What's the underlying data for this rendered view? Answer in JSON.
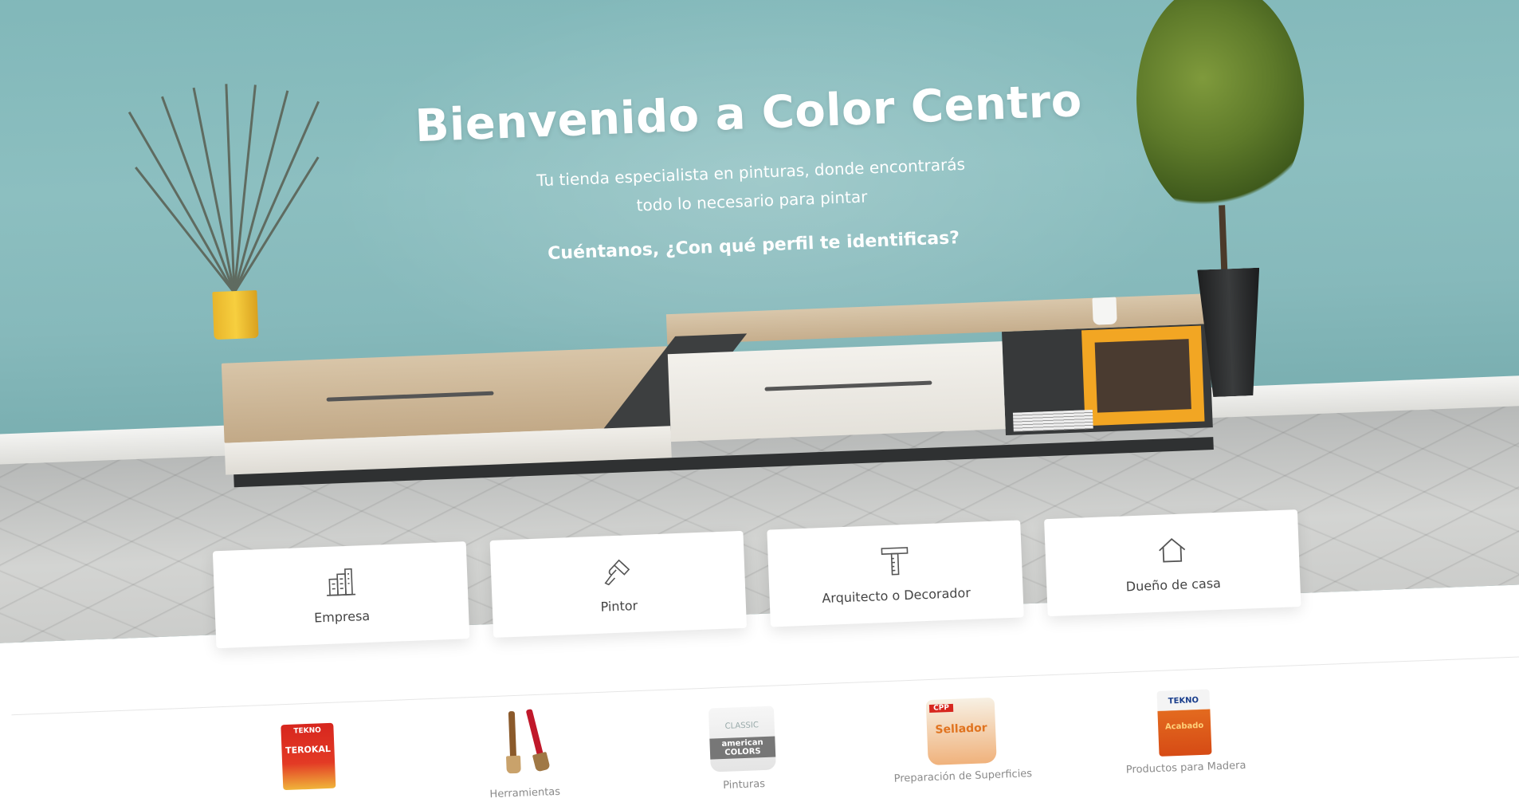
{
  "hero": {
    "title": "Bienvenido a Color Centro",
    "subtitle_line1": "Tu tienda especialista en pinturas, donde encontrarás",
    "subtitle_line2": "todo lo necesario para pintar",
    "question": "Cuéntanos, ¿Con qué perfil te identificas?"
  },
  "profiles": [
    {
      "label": "Empresa",
      "icon": "building-icon"
    },
    {
      "label": "Pintor",
      "icon": "paint-brush-icon"
    },
    {
      "label": "Arquitecto o Decorador",
      "icon": "t-square-ruler-icon"
    },
    {
      "label": "Dueño de casa",
      "icon": "house-icon"
    }
  ],
  "products": [
    {
      "label": "",
      "image": "tekno-terokal-can",
      "brand_text": "TEKNO",
      "product_text": "TEROKAL"
    },
    {
      "label": "Herramientas",
      "image": "paint-brushes"
    },
    {
      "label": "Pinturas",
      "image": "american-colors-bucket",
      "brand_text": "CLASSIC",
      "product_text": "american COLORS"
    },
    {
      "label": "Preparación de Superficies",
      "image": "cpp-sellador-bucket",
      "brand_text": "CPP",
      "product_text": "Sellador"
    },
    {
      "label": "Productos para Madera",
      "image": "tekno-acabado-can",
      "brand_text": "TEKNO",
      "product_text": "Acabado"
    }
  ],
  "colors": {
    "wall": "#86b9bb",
    "card_text": "#444444",
    "product_label": "#8a8a8a",
    "accent_yellow": "#f2a623"
  }
}
